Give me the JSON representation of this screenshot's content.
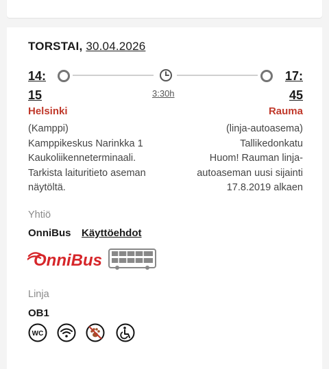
{
  "date": {
    "day": "TORSTAI,",
    "date": "30.04.2026"
  },
  "departure": {
    "time_h": "14:",
    "time_m": "15",
    "city": "Helsinki",
    "stop_lines": [
      "(Kamppi)",
      "Kamppikeskus Narinkka 1",
      "Kaukoliikenneterminaali.",
      "Tarkista laituritieto aseman",
      "näytöltä."
    ]
  },
  "arrival": {
    "time_h": "17:",
    "time_m": "45",
    "city": "Rauma",
    "stop_lines": [
      "(linja-autoasema)",
      "Tallikedonkatu",
      "Huom! Rauman linja-",
      "autoaseman uusi sijainti",
      "17.8.2019 alkaen"
    ]
  },
  "duration": "3:30h",
  "company": {
    "label": "Yhtiö",
    "name": "OnniBus",
    "terms_link": "Käyttöehdot",
    "logo_text": "OnniBus"
  },
  "line": {
    "label": "Linja",
    "id": "OB1"
  },
  "amenities": [
    "wc-icon",
    "wifi-icon",
    "no-pets-icon",
    "wheelchair-icon"
  ],
  "amenity_text": {
    "wc": "WC"
  },
  "colors": {
    "accent_red": "#c0392b",
    "dot_gray": "#757575"
  }
}
